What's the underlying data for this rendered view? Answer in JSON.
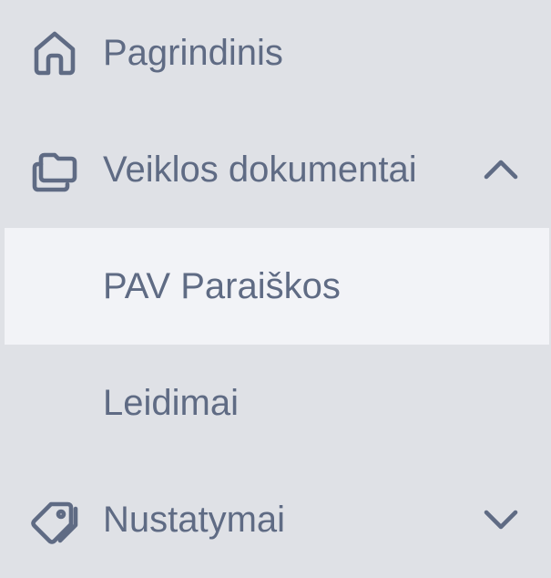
{
  "theme": {
    "background": "#dfe1e6",
    "selected_background": "#f2f3f7",
    "text_color": "#5f6b84"
  },
  "menu": {
    "items": [
      {
        "label": "Pagrindinis",
        "icon": "home-icon"
      },
      {
        "label": "Veiklos dokumentai",
        "icon": "folders-icon",
        "expanded": true,
        "chevron": "chevron-up-icon"
      },
      {
        "label": "PAV Paraiškos",
        "selected": true,
        "level": "submenu"
      },
      {
        "label": "Leidimai",
        "level": "submenu"
      },
      {
        "label": "Nustatymai",
        "icon": "tags-icon",
        "expanded": false,
        "chevron": "chevron-down-icon"
      }
    ]
  }
}
